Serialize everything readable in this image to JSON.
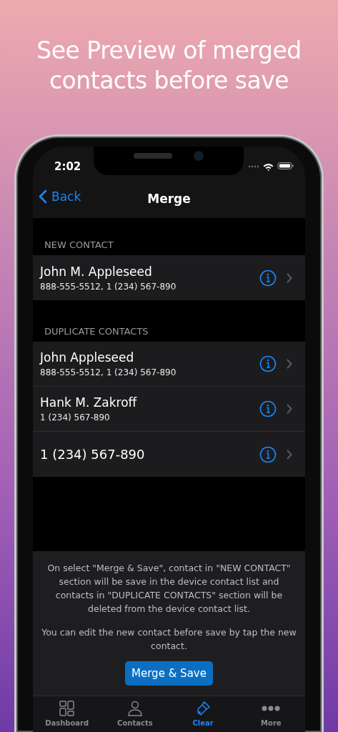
{
  "headline": "See Preview of merged contacts before save",
  "status_bar": {
    "time": "2:02"
  },
  "nav": {
    "back": "Back",
    "title": "Merge"
  },
  "sections": [
    {
      "header": "NEW CONTACT",
      "rows": [
        {
          "name": "John M. Appleseed",
          "detail": "888-555-5512, 1 (234) 567-890"
        }
      ]
    },
    {
      "header": "DUPLICATE CONTACTS",
      "rows": [
        {
          "name": "John Appleseed",
          "detail": "888-555-5512, 1 (234) 567-890"
        },
        {
          "name": "Hank M. Zakroff",
          "detail": "1 (234) 567-890"
        },
        {
          "name": "1 (234) 567-890"
        }
      ]
    }
  ],
  "footer": {
    "notes": [
      "On select \"Merge & Save\", contact in \"NEW CONTACT\" section will be save in the device contact list and contacts in \"DUPLICATE CONTACTS\" section will be deleted from the device contact list.",
      "You can edit the new contact before save by tap the new contact."
    ],
    "button": "Merge & Save"
  },
  "tab_bar": [
    {
      "kind": "dashboard",
      "label": "Dashboard",
      "selected": false
    },
    {
      "kind": "contacts",
      "label": "Contacts",
      "selected": false
    },
    {
      "kind": "clear",
      "label": "Clear",
      "selected": true
    },
    {
      "kind": "more",
      "label": "More",
      "selected": false
    }
  ]
}
